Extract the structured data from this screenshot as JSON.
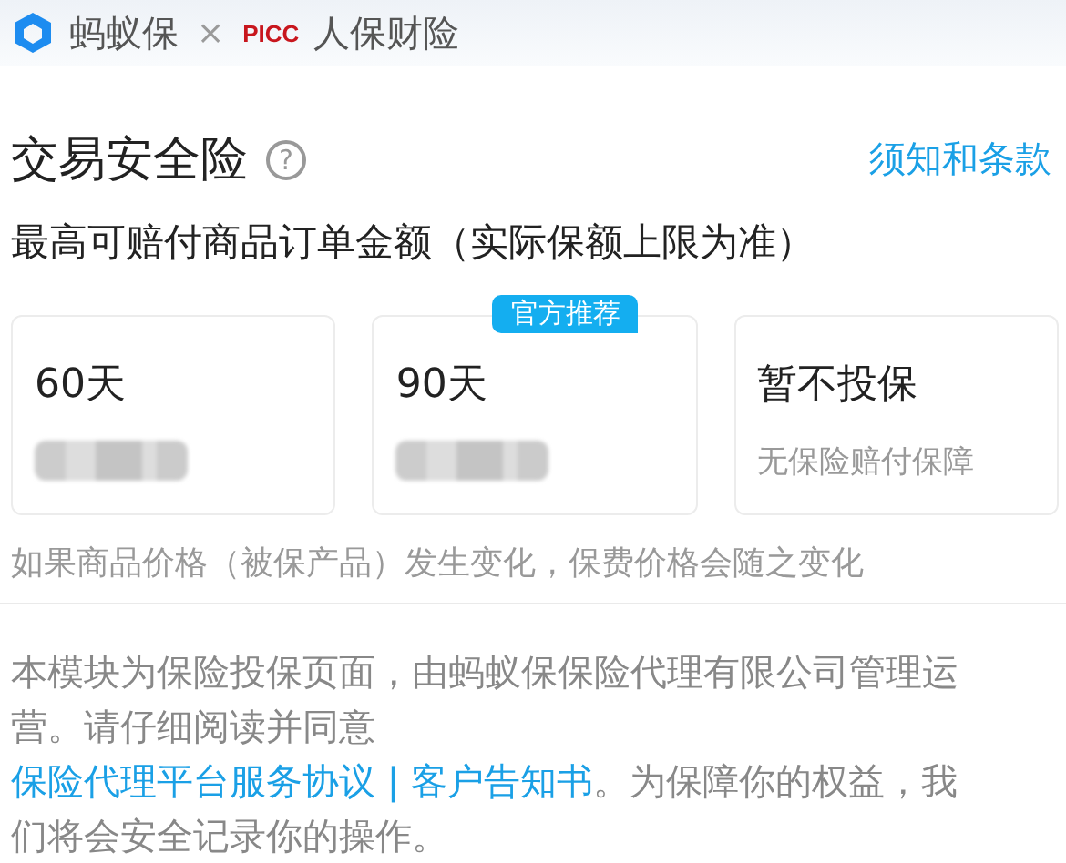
{
  "header": {
    "brand": "蚂蚁保",
    "separator": "×",
    "partner_logo": "PICC",
    "partner": "人保财险"
  },
  "product": {
    "title": "交易安全险",
    "help_icon": "?",
    "terms_link": "须知和条款",
    "subtitle": "最高可赔付商品订单金额（实际保额上限为准）"
  },
  "plans": [
    {
      "kind": "priced",
      "title": "60天",
      "selected": false
    },
    {
      "kind": "priced",
      "title": "90天",
      "badge": "官方推荐",
      "selected": false
    },
    {
      "kind": "none",
      "title": "暂不投保",
      "note": "无保险赔付保障",
      "selected": false
    }
  ],
  "price_note": "如果商品价格（被保产品）发生变化，保费价格会随之变化",
  "disclaimer": [
    {
      "kind": "plain",
      "text": "本模块为保险投保页面，由蚂蚁保保险代理有限公司管理运营。请仔细阅读并同意"
    },
    {
      "kind": "link",
      "text": "保险代理平台服务协议 | 客户告知书"
    },
    {
      "kind": "plain",
      "text": "。为保障你的权益，我们将会安全记录你的操作。"
    }
  ]
}
